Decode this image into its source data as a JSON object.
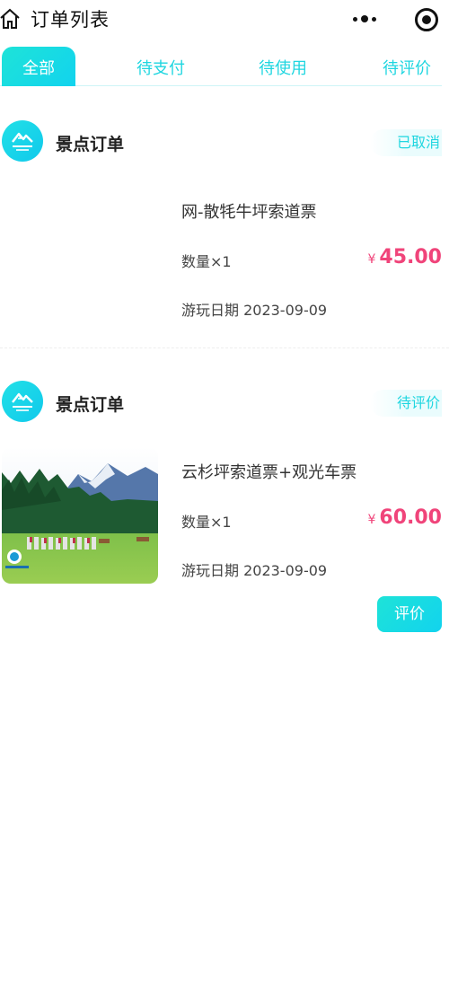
{
  "header": {
    "title": "订单列表",
    "icons": {
      "home": "home-icon",
      "more": "more-dots-icon",
      "capsule": "target-icon"
    }
  },
  "tabs": [
    {
      "label": "全部",
      "active": true
    },
    {
      "label": "待支付",
      "active": false
    },
    {
      "label": "待使用",
      "active": false
    },
    {
      "label": "待评价",
      "active": false
    }
  ],
  "orders": [
    {
      "shop_name": "景点订单",
      "status": "已取消",
      "product_name": "网-散牦牛坪索道票",
      "quantity": "数量×1",
      "currency": "¥",
      "price": "45.00",
      "visit_date": "游玩日期 2023-09-09",
      "has_image": false
    },
    {
      "shop_name": "景点订单",
      "status": "待评价",
      "product_name": "云杉坪索道票+观光车票",
      "quantity": "数量×1",
      "currency": "¥",
      "price": "60.00",
      "visit_date": "游玩日期 2023-09-09",
      "has_image": true,
      "action_label": "评价"
    }
  ],
  "colors": {
    "accent": "#1fd6e0",
    "price": "#f0447a",
    "text": "#333333"
  }
}
